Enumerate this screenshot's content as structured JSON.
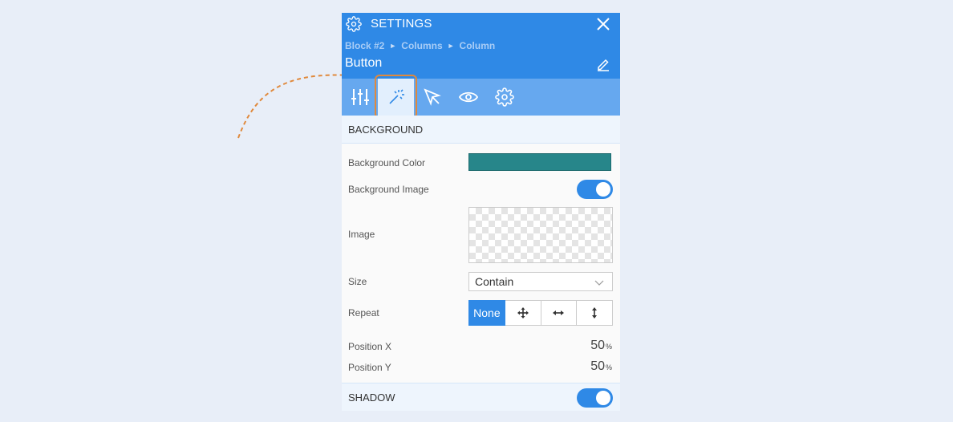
{
  "header": {
    "title": "SETTINGS",
    "breadcrumb": [
      "Block #2",
      "Columns",
      "Column"
    ],
    "element_name": "Button"
  },
  "tabs": [
    {
      "icon": "sliders-icon",
      "active": false
    },
    {
      "icon": "magic-wand-icon",
      "active": true
    },
    {
      "icon": "cursor-icon",
      "active": false
    },
    {
      "icon": "eye-icon",
      "active": false
    },
    {
      "icon": "gear-icon",
      "active": false
    }
  ],
  "background": {
    "section_title": "BACKGROUND",
    "color_label": "Background Color",
    "color_value": "#27868a",
    "image_toggle_label": "Background Image",
    "image_toggle_on": true,
    "image_label": "Image",
    "size_label": "Size",
    "size_value": "Contain",
    "repeat_label": "Repeat",
    "repeat_options": [
      "None",
      "move-icon",
      "horizontal-arrows-icon",
      "vertical-arrows-icon"
    ],
    "repeat_selected": "None",
    "position_x_label": "Position X",
    "position_x_value": "50",
    "position_y_label": "Position Y",
    "position_y_value": "50",
    "unit": "%"
  },
  "shadow": {
    "section_title": "SHADOW",
    "toggle_on": true
  },
  "colors": {
    "header": "#2f89e6",
    "tabs_bar": "#66a8ef",
    "annotation": "#e0893c"
  }
}
